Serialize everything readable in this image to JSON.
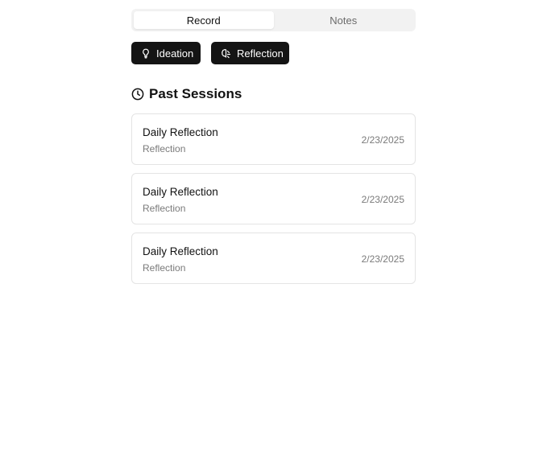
{
  "tabs": [
    {
      "label": "Record",
      "active": true
    },
    {
      "label": "Notes",
      "active": false
    }
  ],
  "modes": [
    {
      "label": "Ideation",
      "icon": "lightbulb-icon"
    },
    {
      "label": "Reflection",
      "icon": "brain-icon"
    }
  ],
  "past_sessions": {
    "heading": "Past Sessions",
    "icon": "clock-icon",
    "items": [
      {
        "title": "Daily Reflection",
        "type": "Reflection",
        "date": "2/23/2025"
      },
      {
        "title": "Daily Reflection",
        "type": "Reflection",
        "date": "2/23/2025"
      },
      {
        "title": "Daily Reflection",
        "type": "Reflection",
        "date": "2/23/2025"
      }
    ]
  },
  "colors": {
    "button_bg": "#141414",
    "tab_track": "#f2f2f2",
    "muted_text": "#7a7a7a",
    "card_border": "#e4e4e4"
  }
}
